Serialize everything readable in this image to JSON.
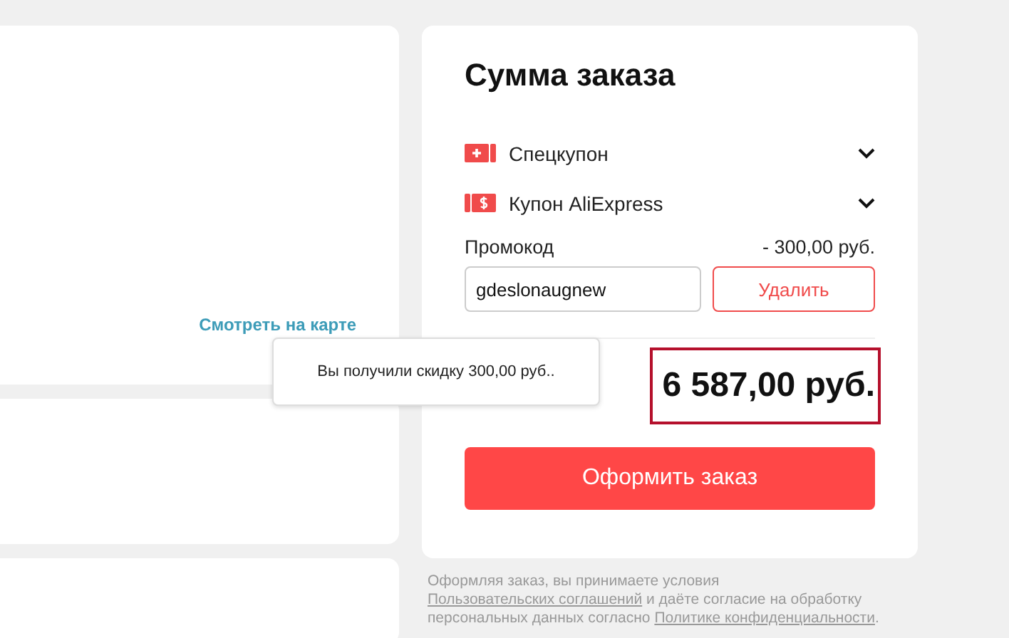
{
  "address_card": {
    "link": "Смотреть на карте"
  },
  "summary": {
    "title": "Сумма заказа",
    "coupons": [
      {
        "kind": "special",
        "label": "Спецкупон",
        "expanded": false
      },
      {
        "kind": "dollar",
        "label": "Купон AliExpress",
        "expanded": false
      }
    ],
    "promo": {
      "label": "Промокод",
      "discount": "- 300,00 руб.",
      "value": "gdeslonaugnew",
      "remove_button": "Удалить"
    },
    "tooltip": "Вы получили скидку 300,00 руб..",
    "total": "6 587,00 руб.",
    "total_highlighted": true,
    "order_button": "Оформить заказ"
  },
  "legal": [
    {
      "kind": "text",
      "text": "Оформляя заказ, вы принимаете условия "
    },
    {
      "kind": "link",
      "text": "Пользовательских соглашений"
    },
    {
      "kind": "text",
      "text": " и даёте согласие на обработку персональных данных согласно "
    },
    {
      "kind": "link",
      "text": "Политике конфиденциальности"
    },
    {
      "kind": "text",
      "text": "."
    }
  ]
}
